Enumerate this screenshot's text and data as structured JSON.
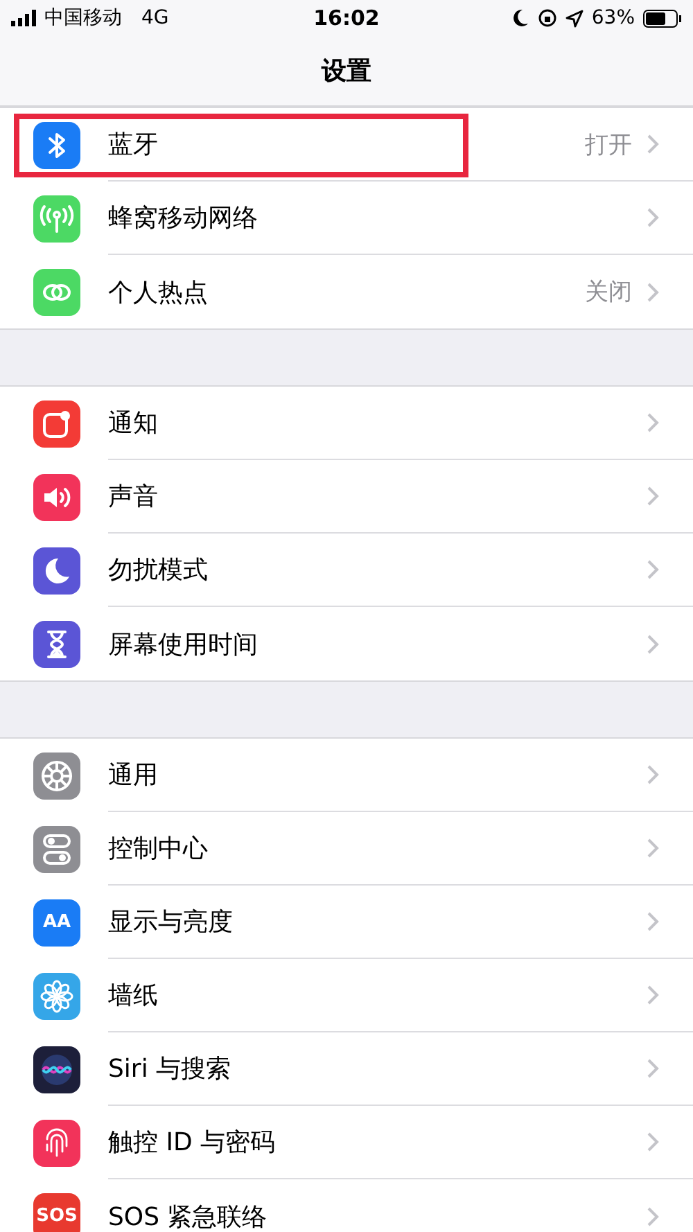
{
  "status_bar": {
    "carrier": "中国移动",
    "network": "4G",
    "time": "16:02",
    "battery": "63%"
  },
  "title": "设置",
  "groups": [
    {
      "items": [
        {
          "label": "蓝牙",
          "value": "打开",
          "kind": "bluetooth",
          "color": "#1a7cf5",
          "highlighted": true
        },
        {
          "label": "蜂窝移动网络",
          "kind": "antenna",
          "color": "#4cd964",
          "highlighted": false
        },
        {
          "label": "个人热点",
          "value": "关闭",
          "kind": "link",
          "color": "#4cd964",
          "highlighted": false
        }
      ]
    },
    {
      "items": [
        {
          "label": "通知",
          "kind": "notification",
          "color": "#f33b36",
          "highlighted": false
        },
        {
          "label": "声音",
          "kind": "speaker",
          "color": "#f2335a",
          "highlighted": false
        },
        {
          "label": "勿扰模式",
          "kind": "moon",
          "color": "#5b55d6",
          "highlighted": false
        },
        {
          "label": "屏幕使用时间",
          "kind": "hourglass",
          "color": "#5b55d6",
          "highlighted": false
        }
      ]
    },
    {
      "items": [
        {
          "label": "通用",
          "kind": "gear",
          "color": "#8e8e93",
          "highlighted": false
        },
        {
          "label": "控制中心",
          "kind": "toggles",
          "color": "#8e8e93",
          "highlighted": false
        },
        {
          "label": "显示与亮度",
          "kind": "text",
          "icon_text": "AA",
          "color": "#1a7cf5",
          "highlighted": false
        },
        {
          "label": "墙纸",
          "kind": "flower",
          "color": "#35a6e8",
          "highlighted": false
        },
        {
          "label": "Siri 与搜索",
          "kind": "orb",
          "color": "#1d1f3a",
          "highlighted": false
        },
        {
          "label": "触控 ID 与密码",
          "kind": "fingerprint",
          "color": "#f2335a",
          "highlighted": false
        },
        {
          "label": "SOS 紧急联络",
          "kind": "text",
          "icon_text": "SOS",
          "color": "#e8392f",
          "highlighted": false
        }
      ]
    }
  ]
}
